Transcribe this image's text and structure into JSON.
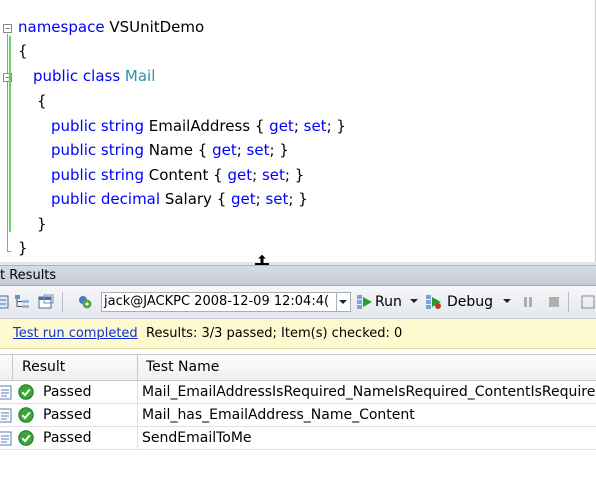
{
  "editor": {
    "lines": [
      {
        "parts": [
          {
            "t": "namespace ",
            "c": "kw"
          },
          {
            "t": "VSUnitDemo",
            "c": ""
          }
        ]
      },
      {
        "parts": [
          {
            "t": "{",
            "c": ""
          }
        ]
      },
      {
        "parts": [
          {
            "t": "public class ",
            "c": "kw"
          },
          {
            "t": "Mail",
            "c": "ty"
          }
        ]
      },
      {
        "parts": [
          {
            "t": "{",
            "c": ""
          }
        ]
      },
      {
        "parts": [
          {
            "t": "public string ",
            "c": "kw"
          },
          {
            "t": "EmailAddress { ",
            "c": ""
          },
          {
            "t": "get",
            "c": "kw"
          },
          {
            "t": "; ",
            "c": ""
          },
          {
            "t": "set",
            "c": "kw"
          },
          {
            "t": "; }",
            "c": ""
          }
        ]
      },
      {
        "parts": [
          {
            "t": "public string ",
            "c": "kw"
          },
          {
            "t": "Name { ",
            "c": ""
          },
          {
            "t": "get",
            "c": "kw"
          },
          {
            "t": "; ",
            "c": ""
          },
          {
            "t": "set",
            "c": "kw"
          },
          {
            "t": "; }",
            "c": ""
          }
        ]
      },
      {
        "parts": [
          {
            "t": "public string ",
            "c": "kw"
          },
          {
            "t": "Content { ",
            "c": ""
          },
          {
            "t": "get",
            "c": "kw"
          },
          {
            "t": "; ",
            "c": ""
          },
          {
            "t": "set",
            "c": "kw"
          },
          {
            "t": "; }",
            "c": ""
          }
        ]
      },
      {
        "parts": [
          {
            "t": "public decimal ",
            "c": "kw"
          },
          {
            "t": "Salary { ",
            "c": ""
          },
          {
            "t": "get",
            "c": "kw"
          },
          {
            "t": "; ",
            "c": ""
          },
          {
            "t": "set",
            "c": "kw"
          },
          {
            "t": "; }",
            "c": ""
          }
        ]
      },
      {
        "parts": [
          {
            "t": "}",
            "c": ""
          }
        ]
      },
      {
        "parts": [
          {
            "t": "}",
            "c": ""
          }
        ]
      }
    ]
  },
  "pane": {
    "title": "t Results"
  },
  "toolbar": {
    "run_combo_value": "jack@JACKPC 2008-12-09 12:04:4(",
    "run_label": "Run",
    "debug_label": "Debug"
  },
  "infobar": {
    "link": "Test run completed",
    "message": "Results: 3/3 passed;  Item(s) checked: 0"
  },
  "grid": {
    "headers": [
      "Result",
      "Test Name"
    ],
    "rows": [
      {
        "result": "Passed",
        "name": "Mail_EmailAddressIsRequired_NameIsRequired_ContentIsRequired"
      },
      {
        "result": "Passed",
        "name": "Mail_has_EmailAddress_Name_Content"
      },
      {
        "result": "Passed",
        "name": "SendEmailToMe"
      }
    ]
  },
  "colors": {
    "keyword": "#0000ff",
    "type": "#2b91af",
    "change_bar": "#6ad16a",
    "info_bar": "#fff9cf",
    "link": "#1030d0",
    "pass_icon": "#3aa63a"
  },
  "icons": [
    "fold-minus-icon",
    "resize-vertical-icon",
    "toolbar-view-icon",
    "toolbar-group-icon",
    "toolbar-window-icon",
    "run-config-icon",
    "run-icon",
    "debug-icon",
    "pause-icon",
    "stop-icon",
    "test-item-icon",
    "passed-check-icon"
  ]
}
